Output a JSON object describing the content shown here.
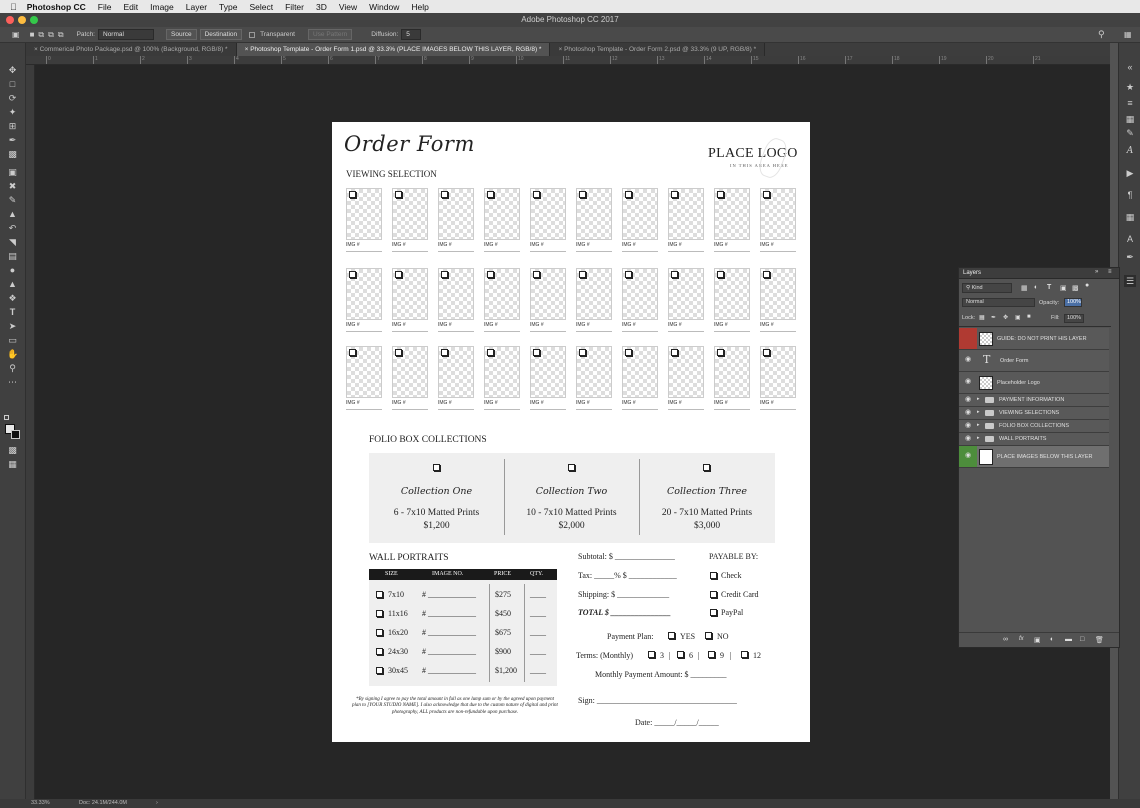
{
  "app": {
    "menu": [
      "Photoshop CC",
      "File",
      "Edit",
      "Image",
      "Layer",
      "Type",
      "Select",
      "Filter",
      "3D",
      "View",
      "Window",
      "Help"
    ],
    "window_title": "Adobe Photoshop CC 2017"
  },
  "options": {
    "patch_label": "Patch:",
    "patch_value": "Normal",
    "source": "Source",
    "destination": "Destination",
    "transparent": "Transparent",
    "use_pattern": "Use Pattern",
    "diffusion_label": "Diffusion:",
    "diffusion_value": "5"
  },
  "tabs": [
    "Commerical Photo Package.psd @ 100% (Background, RGB/8) *",
    "Photoshop Template - Order Form 1.psd @ 33.3% (PLACE IMAGES BELOW THIS LAYER, RGB/8) *",
    "Photoshop Template - Order Form 2.psd @ 33.3% (9 UP, RGB/8) *"
  ],
  "ruler_ticks": [
    "0",
    "1",
    "2",
    "3",
    "4",
    "5",
    "6",
    "7",
    "8",
    "9",
    "10",
    "11",
    "12",
    "13",
    "14",
    "15",
    "16",
    "17",
    "18",
    "19",
    "20",
    "21"
  ],
  "doc": {
    "title": "Order Form",
    "logo_main": "PLACE LOGO",
    "logo_sub": "IN THIS AREA HERE",
    "viewing_heading": "VIEWING SELECTION",
    "img_label": "IMG #",
    "folio_heading": "FOLIO BOX COLLECTIONS",
    "collections": [
      {
        "name": "Collection One",
        "desc": "6 - 7x10 Matted Prints",
        "price": "$1,200"
      },
      {
        "name": "Collection Two",
        "desc": "10 - 7x10 Matted Prints",
        "price": "$2,000"
      },
      {
        "name": "Collection Three",
        "desc": "20 - 7x10 Matted Prints",
        "price": "$3,000"
      }
    ],
    "wall_heading": "WALL PORTRAITS",
    "wall_headers": [
      "SIZE",
      "IMAGE NO.",
      "PRICE",
      "QTY."
    ],
    "wall_rows": [
      {
        "size": "7x10",
        "img": "#",
        "price": "$275"
      },
      {
        "size": "11x16",
        "img": "#",
        "price": "$450"
      },
      {
        "size": "16x20",
        "img": "#",
        "price": "$675"
      },
      {
        "size": "24x30",
        "img": "#",
        "price": "$900"
      },
      {
        "size": "30x45",
        "img": "#",
        "price": "$1,200"
      }
    ],
    "subtotal": "Subtotal: $ _______________",
    "tax": "Tax: _____% $ ____________",
    "shipping": "Shipping: $ _____________",
    "total": "TOTAL $ _______________",
    "payable_by": "PAYABLE BY:",
    "payable_options": [
      "Check",
      "Credit Card",
      "PayPal"
    ],
    "payment_plan": "Payment Plan:",
    "yes": "YES",
    "no": "NO",
    "terms": "Terms: (Monthly)",
    "terms_options": [
      "3",
      "6",
      "9",
      "12"
    ],
    "monthly": "Monthly Payment Amount: $ _________",
    "sign": "Sign: ___________________________________",
    "date": "Date: _____/_____/_____",
    "disclaimer": "*By signing I agree to pay the total amount in full as one lump sum or by the agreed upon payment plan to [YOUR STUDIO NAME]. I also acknowledge that due to the custom nature of digital and print photography, ALL products are non-refundable upon purchase."
  },
  "layers_panel": {
    "title": "Layers",
    "kind": "Kind",
    "blend": "Normal",
    "opacity_label": "Opacity:",
    "opacity_value": "100%",
    "lock_label": "Lock:",
    "fill_label": "Fill:",
    "fill_value": "100%",
    "layers": [
      {
        "name": "GUIDE: DO NOT PRINT HIS LAYER",
        "kind": "guide"
      },
      {
        "name": "Order Form",
        "kind": "text"
      },
      {
        "name": "Placeholder Logo",
        "kind": "image"
      },
      {
        "name": "PAYMENT INFORMATION",
        "kind": "group"
      },
      {
        "name": "VIEWING SELECTIONS",
        "kind": "group"
      },
      {
        "name": "FOLIO BOX COLLECTIONS",
        "kind": "group"
      },
      {
        "name": "WALL PORTRAITS",
        "kind": "group"
      },
      {
        "name": "PLACE IMAGES BELOW THIS LAYER",
        "kind": "selected"
      }
    ]
  },
  "status": {
    "zoom": "33.33%",
    "doc": "Doc: 24.1M/244.0M"
  }
}
